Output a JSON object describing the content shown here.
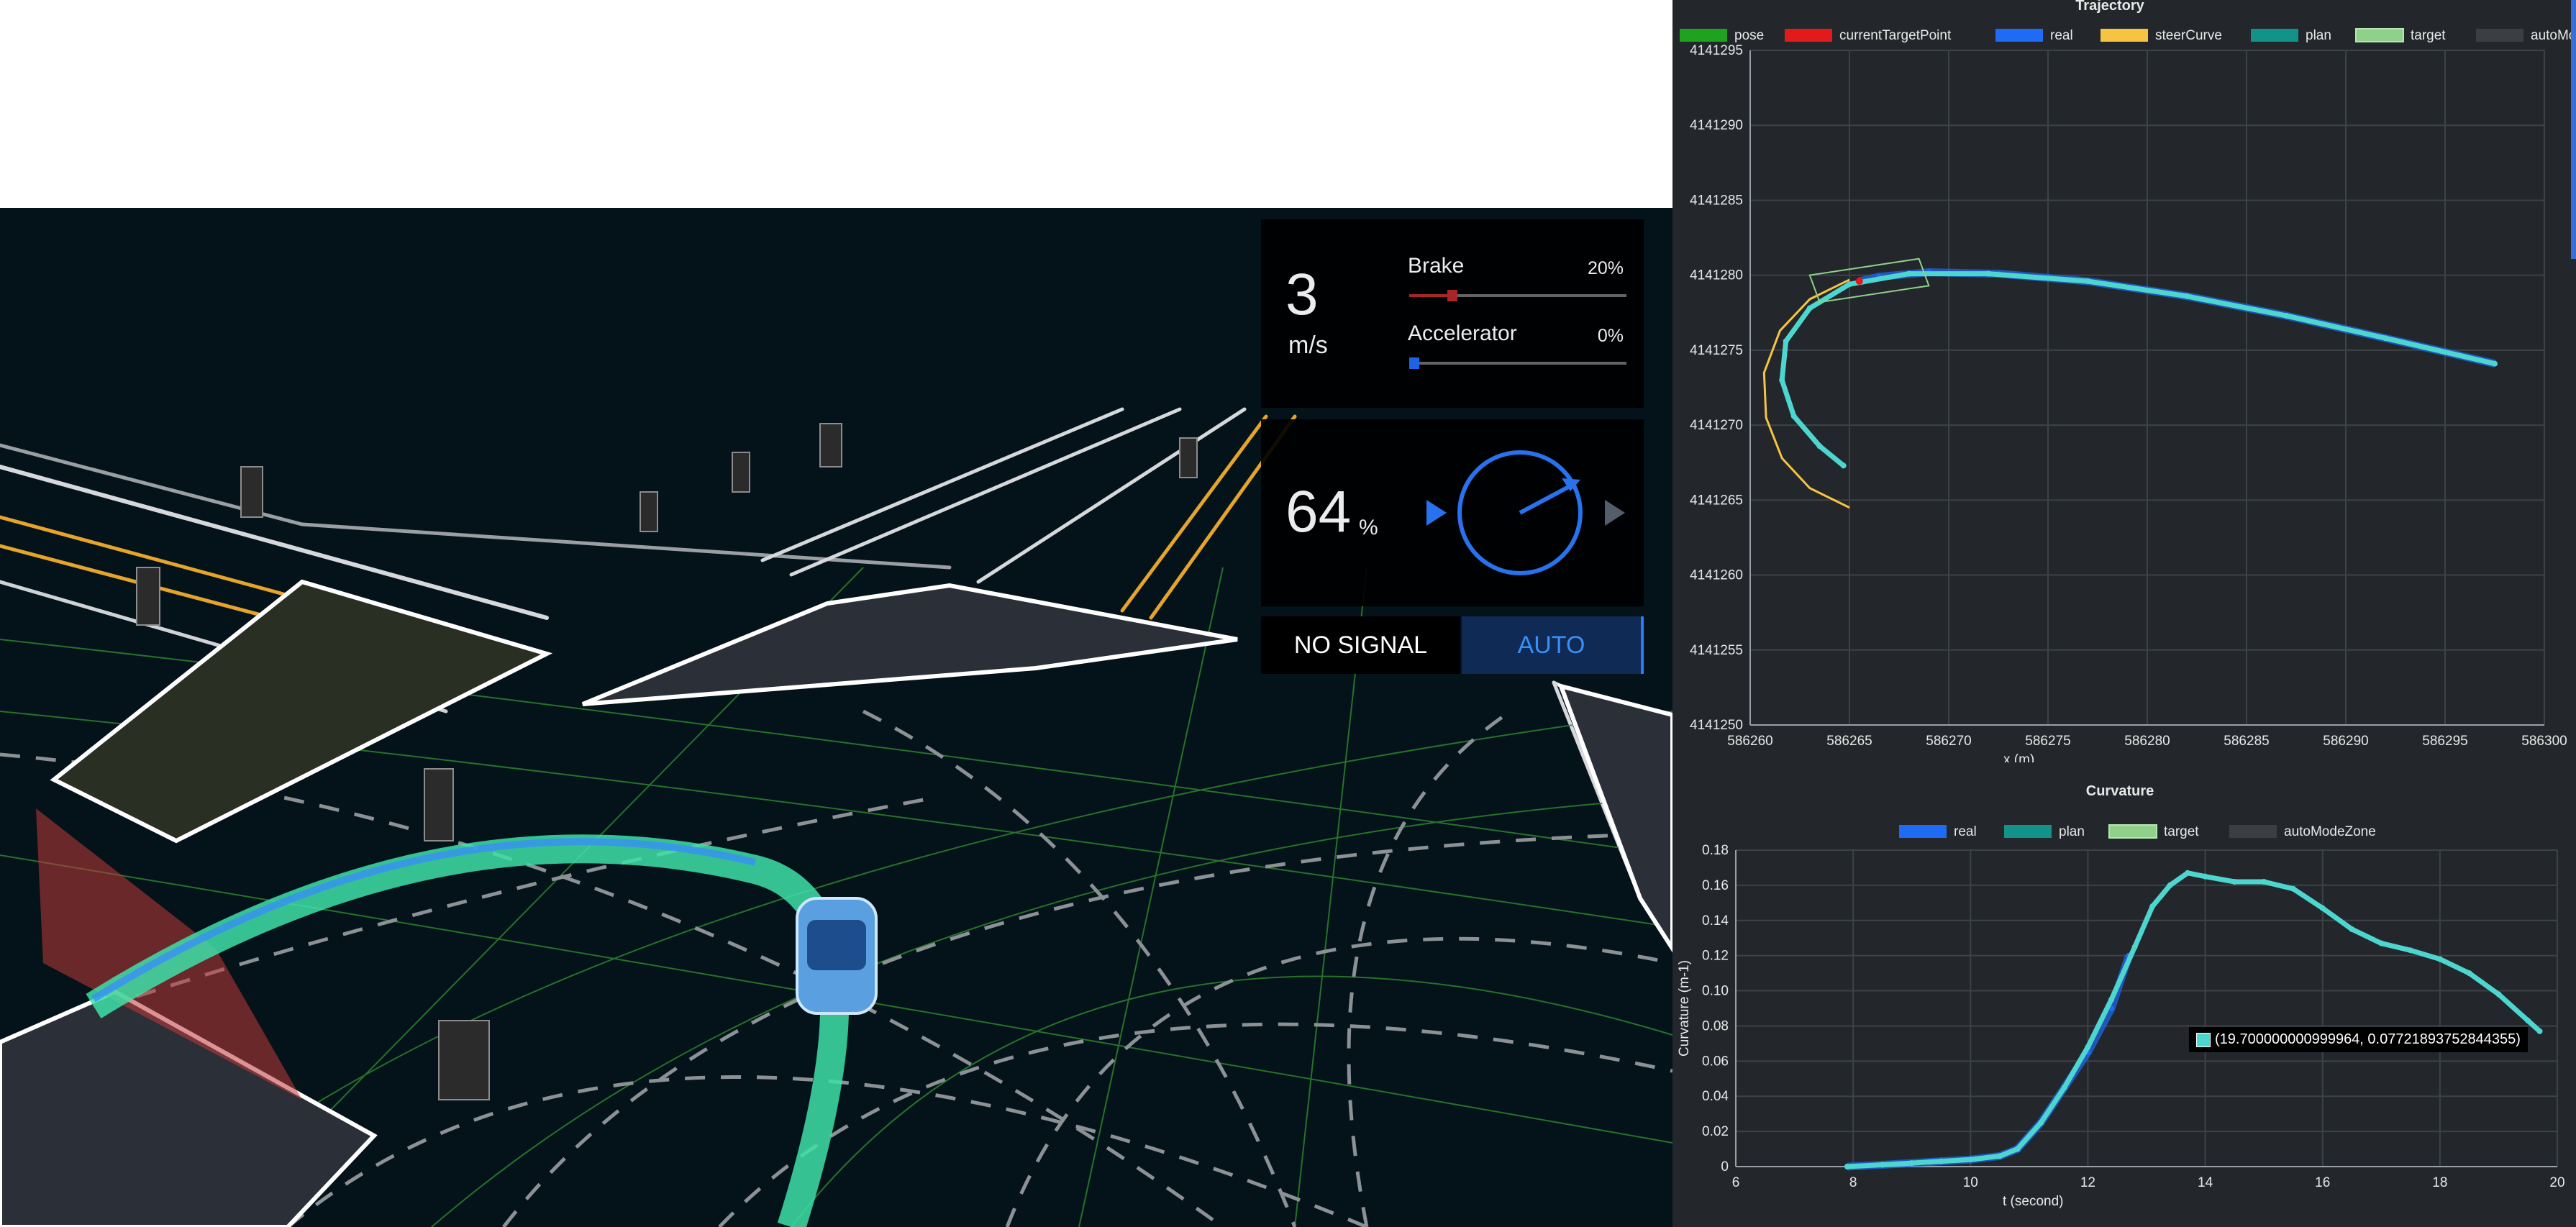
{
  "dashboard": {
    "speed": "3",
    "speed_unit": "m/s",
    "brake": {
      "label": "Brake",
      "value_text": "20%",
      "fraction": 0.2,
      "color": "#b5292a"
    },
    "accelerator": {
      "label": "Accelerator",
      "value_text": "0%",
      "fraction": 0.0,
      "color": "#1f6bf5"
    },
    "steering": "64",
    "steering_unit": "%",
    "steering_fraction": 0.64,
    "signal_label": "NO SIGNAL",
    "mode_label": "AUTO",
    "accent": "#2c7bff"
  },
  "icons": {
    "steer_left": "triangle-left-icon",
    "steer_right": "triangle-right-icon",
    "wheel": "steering-wheel-icon"
  },
  "chart_data": [
    {
      "type": "line",
      "title": "Trajectory",
      "xlabel": "x (m)",
      "ylabel": "",
      "xlim": [
        586260,
        586300
      ],
      "ylim": [
        4141250,
        4141295
      ],
      "x_ticks": [
        "586260",
        "586265",
        "586270",
        "586275",
        "586280",
        "586285",
        "586290",
        "586295",
        "586300"
      ],
      "y_ticks": [
        "4141295",
        "4141290",
        "4141285",
        "4141280",
        "4141275",
        "4141270",
        "4141265",
        "4141260",
        "4141255",
        "4141250"
      ],
      "legend": [
        {
          "name": "pose",
          "color": "#1fa31f"
        },
        {
          "name": "currentTargetPoint",
          "color": "#e31a1a"
        },
        {
          "name": "real",
          "color": "#1f6bf5"
        },
        {
          "name": "steerCurve",
          "color": "#f6c343"
        },
        {
          "name": "plan",
          "color": "#12938a"
        },
        {
          "name": "target",
          "color": "#8fd18b"
        },
        {
          "name": "autoModeZone",
          "color": "#3b3f44"
        }
      ],
      "legend_position": "top",
      "grid": true,
      "series": [
        {
          "name": "real",
          "color": "#1f6bf5",
          "points": [
            [
              586297.5,
              4141274.1
            ],
            [
              586292,
              4141275.8
            ],
            [
              586287,
              4141277.3
            ],
            [
              586282,
              4141278.6
            ],
            [
              586277,
              4141279.6
            ],
            [
              586272.5,
              4141280.1
            ],
            [
              586269,
              4141280.2
            ],
            [
              586266.5,
              4141279.9
            ],
            [
              586265.5,
              4141279.6
            ]
          ]
        },
        {
          "name": "plan",
          "color": "#4dd6cf",
          "points": [
            [
              586297.5,
              4141274.1
            ],
            [
              586292,
              4141275.8
            ],
            [
              586287,
              4141277.3
            ],
            [
              586282,
              4141278.6
            ],
            [
              586277,
              4141279.6
            ],
            [
              586272,
              4141280.1
            ],
            [
              586268,
              4141280.1
            ],
            [
              586265,
              4141279.4
            ],
            [
              586263,
              4141277.8
            ],
            [
              586261.8,
              4141275.6
            ],
            [
              586261.6,
              4141273
            ],
            [
              586262.2,
              4141270.6
            ],
            [
              586263.5,
              4141268.6
            ],
            [
              586264.7,
              4141267.3
            ]
          ]
        },
        {
          "name": "steerCurve",
          "color": "#f6c343",
          "points": [
            [
              586265,
              4141279.7
            ],
            [
              586263,
              4141278.4
            ],
            [
              586261.5,
              4141276.3
            ],
            [
              586260.7,
              4141273.5
            ],
            [
              586260.8,
              4141270.5
            ],
            [
              586261.6,
              4141267.8
            ],
            [
              586263,
              4141265.8
            ],
            [
              586265,
              4141264.5
            ]
          ]
        },
        {
          "name": "currentTargetPoint",
          "color": "#e31a1a",
          "points": [
            [
              586265.5,
              4141279.6
            ]
          ]
        },
        {
          "name": "target",
          "color": "#8fd18b",
          "polygon": [
            [
              586263,
              4141280
            ],
            [
              586268.5,
              4141281.1
            ],
            [
              586269,
              4141279.3
            ],
            [
              586263.5,
              4141278.2
            ]
          ]
        }
      ]
    },
    {
      "type": "line",
      "title": "Curvature",
      "xlabel": "t (second)",
      "ylabel": "Curvature (m-1)",
      "xlim": [
        6,
        20
      ],
      "ylim": [
        0,
        0.18
      ],
      "x_ticks": [
        "6",
        "8",
        "10",
        "12",
        "14",
        "16",
        "18",
        "20"
      ],
      "y_ticks": [
        "0.18",
        "0.16",
        "0.14",
        "0.12",
        "0.10",
        "0.08",
        "0.06",
        "0.04",
        "0.02",
        "0"
      ],
      "legend": [
        {
          "name": "real",
          "color": "#1f6bf5"
        },
        {
          "name": "plan",
          "color": "#12938a"
        },
        {
          "name": "target",
          "color": "#8fd18b"
        },
        {
          "name": "autoModeZone",
          "color": "#3b3f44"
        }
      ],
      "legend_position": "top",
      "grid": true,
      "tooltip": "(19.700000000999964, 0.07721893752844355)",
      "series": [
        {
          "name": "real",
          "color": "#1f6bf5",
          "points": [
            [
              7.9,
              0
            ],
            [
              8.5,
              0.001
            ],
            [
              9,
              0.002
            ],
            [
              9.5,
              0.003
            ],
            [
              10,
              0.004
            ],
            [
              10.5,
              0.006
            ],
            [
              10.8,
              0.01
            ],
            [
              11.2,
              0.025
            ],
            [
              11.6,
              0.045
            ],
            [
              12,
              0.065
            ],
            [
              12.4,
              0.09
            ],
            [
              12.7,
              0.12
            ]
          ]
        },
        {
          "name": "plan",
          "color": "#4dd6cf",
          "points": [
            [
              7.9,
              0
            ],
            [
              8.5,
              0.001
            ],
            [
              9,
              0.002
            ],
            [
              9.5,
              0.003
            ],
            [
              10,
              0.004
            ],
            [
              10.5,
              0.006
            ],
            [
              10.8,
              0.01
            ],
            [
              11.2,
              0.025
            ],
            [
              11.6,
              0.045
            ],
            [
              12,
              0.068
            ],
            [
              12.4,
              0.095
            ],
            [
              12.8,
              0.125
            ],
            [
              13.1,
              0.148
            ],
            [
              13.4,
              0.16
            ],
            [
              13.7,
              0.167
            ],
            [
              14,
              0.165
            ],
            [
              14.5,
              0.162
            ],
            [
              15,
              0.162
            ],
            [
              15.5,
              0.158
            ],
            [
              16,
              0.147
            ],
            [
              16.5,
              0.135
            ],
            [
              17,
              0.127
            ],
            [
              17.5,
              0.123
            ],
            [
              18,
              0.118
            ],
            [
              18.5,
              0.11
            ],
            [
              19,
              0.098
            ],
            [
              19.5,
              0.083
            ],
            [
              19.7,
              0.077
            ]
          ]
        }
      ]
    }
  ]
}
